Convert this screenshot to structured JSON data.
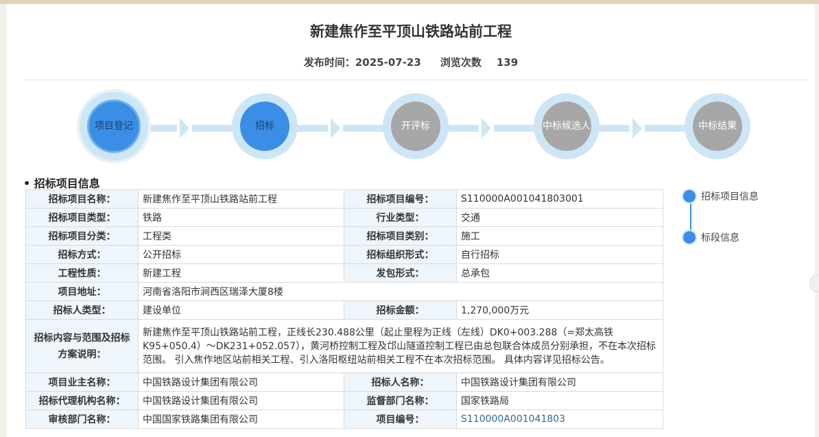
{
  "header": {
    "title": "新建焦作至平顶山铁路站前工程",
    "publish_label": "发布时间：",
    "publish_date": "2025-07-23",
    "views_label": "浏览次数",
    "views_count": "139"
  },
  "steps": [
    {
      "label_line1": "项目",
      "label_line2": "登记",
      "state": "current"
    },
    {
      "label_line1": "招标",
      "label_line2": "",
      "state": "active"
    },
    {
      "label_line1": "开评标",
      "label_line2": "",
      "state": "pending"
    },
    {
      "label_line1": "中标",
      "label_line2": "候选人",
      "state": "pending"
    },
    {
      "label_line1": "中标",
      "label_line2": "结果",
      "state": "pending"
    }
  ],
  "section": {
    "title": "• 招标项目信息"
  },
  "table": {
    "rows": [
      {
        "l1": "招标项目名称：",
        "v1": "新建焦作至平顶山铁路站前工程",
        "l2": "招标项目编号：",
        "v2": "S110000A001041803001"
      },
      {
        "l1": "招标项目类型：",
        "v1": "铁路",
        "l2": "行业类型：",
        "v2": "交通"
      },
      {
        "l1": "招标项目分类：",
        "v1": "工程类",
        "l2": "招标项目类别：",
        "v2": "施工"
      },
      {
        "l1": "招标方式：",
        "v1": "公开招标",
        "l2": "招标组织形式：",
        "v2": "自行招标"
      },
      {
        "l1": "工程性质：",
        "v1": "新建工程",
        "l2": "发包形式：",
        "v2": "总承包"
      },
      {
        "l1": "项目地址：",
        "v1": "河南省洛阳市涧西区瑞泽大厦8楼"
      },
      {
        "l1": "招标人类型：",
        "v1": "建设单位",
        "l2": "招标金额：",
        "v2": "1,270,000万元"
      },
      {
        "l1": "招标内容与范围及招标方案说明：",
        "v1": "新建焦作至平顶山铁路站前工程，正线长230.488公里（起止里程为正线（左线）DK0+003.288（=郑太高铁K95+050.4）～DK231+052.057），黄河桥控制工程及邙山隧道控制工程已由总包联合体成员分别承担，不在本次招标范围。 引入焦作地区站前相关工程、引入洛阳枢纽站前相关工程不在本次招标范围。 具体内容详见招标公告。"
      },
      {
        "l1": "项目业主名称：",
        "v1": "中国铁路设计集团有限公司",
        "l2": "招标人名称：",
        "v2": "中国铁路设计集团有限公司"
      },
      {
        "l1": "招标代理机构名称：",
        "v1": "中国铁路设计集团有限公司",
        "l2": "监督部门名称：",
        "v2": "国家铁路局"
      },
      {
        "l1": "审核部门名称：",
        "v1": "中国国家铁路集团有限公司",
        "l2": "项目编号：",
        "v2": "S110000A001041803"
      }
    ]
  },
  "side_nav": {
    "items": [
      {
        "label": "招标项目信息"
      },
      {
        "label": "标段信息"
      }
    ]
  },
  "colors": {
    "accent": "#3b8ee6",
    "step_ring": "#cde6f6",
    "step_pending": "#a7a7a7",
    "label_bg": "#eef5fb",
    "link": "#2b6b9e"
  }
}
